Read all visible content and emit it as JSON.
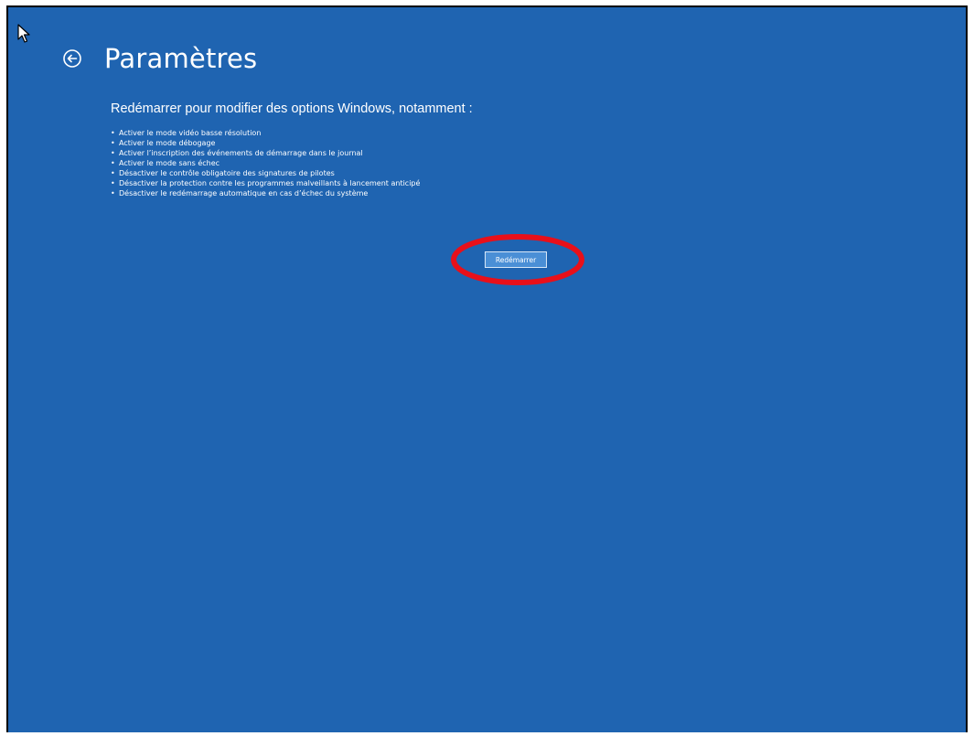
{
  "header": {
    "title": "Paramètres"
  },
  "subtitle": "Redémarrer pour modifier des options Windows, notamment :",
  "options": [
    "Activer le mode vidéo basse résolution",
    "Activer le mode débogage",
    "Activer l’inscription des événements de démarrage dans le journal",
    "Activer le mode sans échec",
    "Désactiver le contrôle obligatoire des signatures de pilotes",
    "Désactiver la protection contre les programmes malveillants à lancement anticipé",
    "Désactiver le redémarrage automatique en cas d’échec du système"
  ],
  "bullet": "•",
  "restart_button": {
    "label": "Redémarrer"
  },
  "icons": {
    "back": "back-arrow-circle-icon",
    "cursor": "mouse-pointer-icon"
  },
  "colors": {
    "background": "#1f64b1",
    "button": "#4a8fd6",
    "annotation": "#e8101a",
    "text": "#ffffff"
  }
}
